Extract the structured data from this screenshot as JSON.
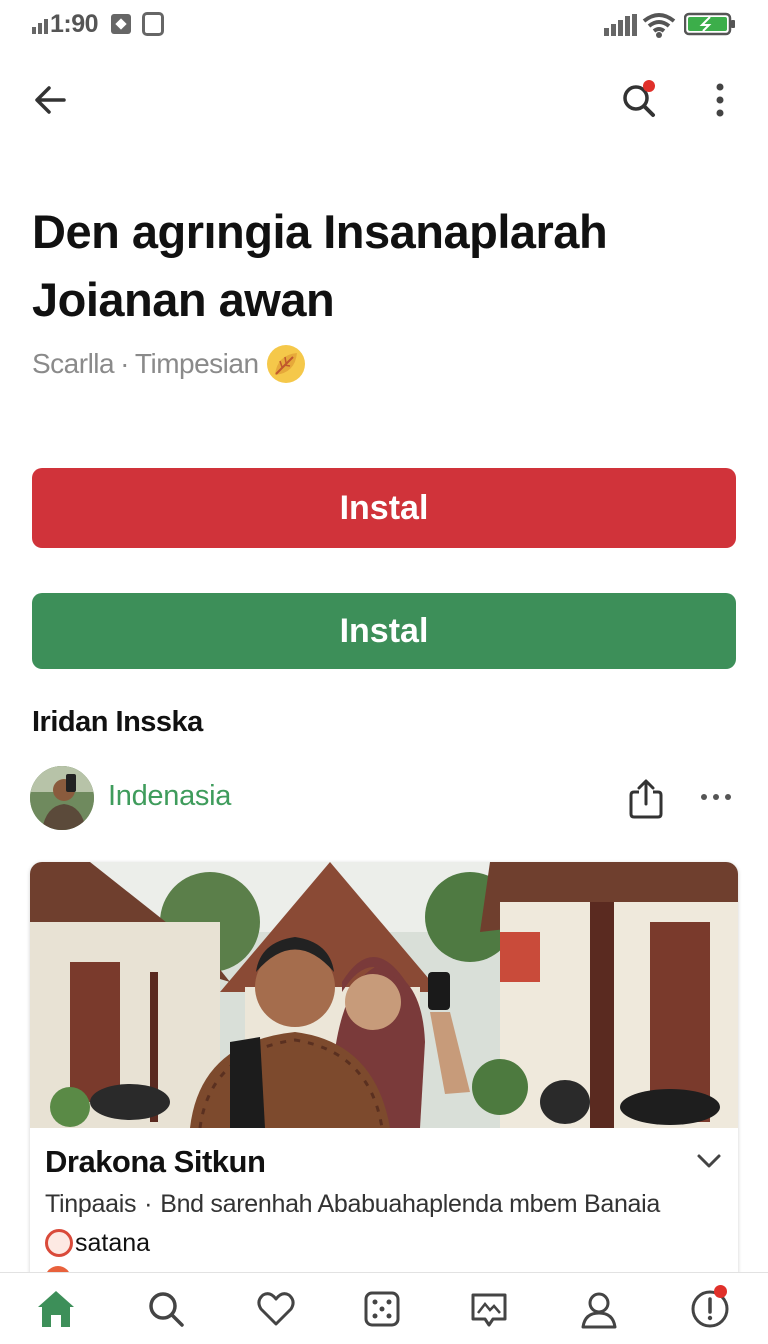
{
  "status_bar": {
    "time": "1:90",
    "accent_battery": "#3cae4a"
  },
  "title": "Den agrıngia Insanaplarah Joianan awan",
  "subtitle": {
    "part1": "Scarlla",
    "separator": "·",
    "part2": "Timpesian",
    "emoji_icon": "leaf-emoji-icon"
  },
  "buttons": {
    "primary_label": "Instal",
    "secondary_label": "Instal",
    "primary_color": "#d0333a",
    "secondary_color": "#3d8f59"
  },
  "section_title": "Iridan Insska",
  "author": {
    "name": "Indenasia",
    "name_color": "#3f9c5c"
  },
  "card": {
    "title": "Drakona Sitkun",
    "meta_left": "Tinpaais",
    "meta_separator": "·",
    "meta_right": "Bnd sarenhah Ababuahaplenda mbem Banaia",
    "tag_label": "satana"
  },
  "bottom_nav": {
    "items": [
      "home-icon",
      "search-icon",
      "heart-icon",
      "dice-icon",
      "chat-image-icon",
      "profile-icon",
      "alert-icon"
    ],
    "active_color": "#3d8f59"
  }
}
